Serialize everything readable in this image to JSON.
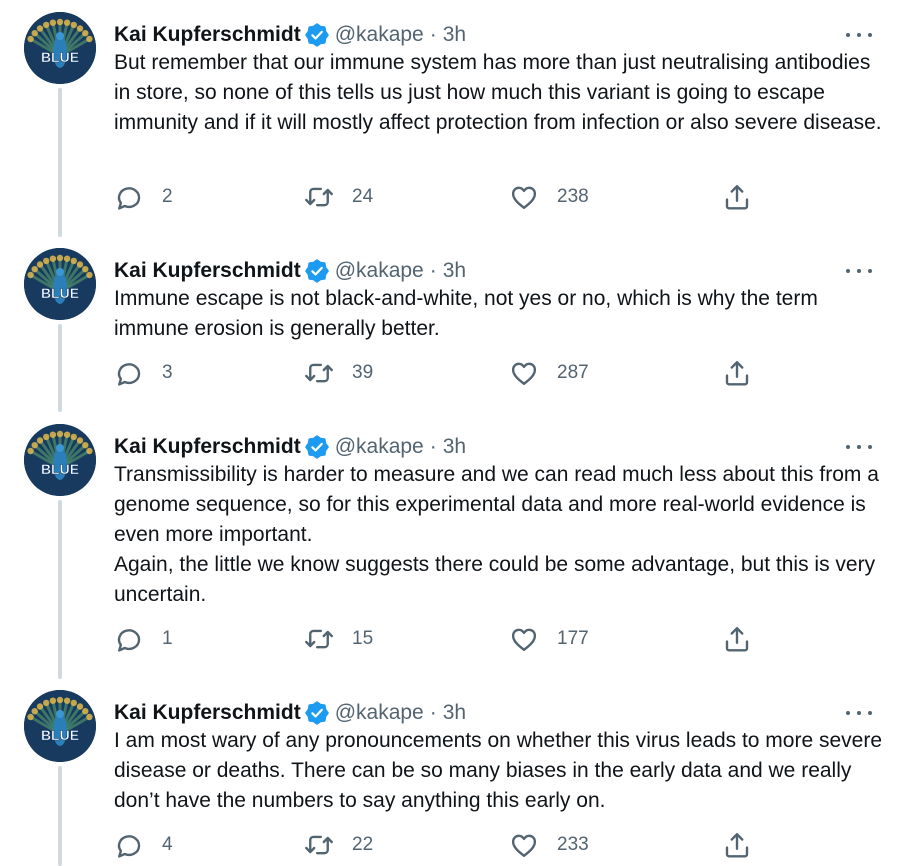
{
  "colors": {
    "verified_badge": "#1d9bf0",
    "secondary_text": "#536471",
    "thread_line": "#cfd9de"
  },
  "avatar_text": "BLUE",
  "tweets": [
    {
      "author_name": "Kai Kupferschmidt",
      "handle": "@kakape",
      "separator": "·",
      "time": "3h",
      "text": [
        "But remember that our immune system has more than just neutralising antibodies in store, so none of this tells us just how much this variant is going to escape immunity and if it will mostly affect protection from infection or also severe disease."
      ],
      "replies": "2",
      "retweets": "24",
      "likes": "238"
    },
    {
      "author_name": "Kai Kupferschmidt",
      "handle": "@kakape",
      "separator": "·",
      "time": "3h",
      "text": [
        "Immune escape is not black-and-white, not yes or no, which is why the term immune erosion is generally better."
      ],
      "replies": "3",
      "retweets": "39",
      "likes": "287"
    },
    {
      "author_name": "Kai Kupferschmidt",
      "handle": "@kakape",
      "separator": "·",
      "time": "3h",
      "text": [
        "Transmissibility is harder to measure and we can read much less about this from a genome sequence, so for this experimental data and more real-world evidence is even more important.",
        "Again, the little we know suggests there could be some advantage, but this is very uncertain."
      ],
      "replies": "1",
      "retweets": "15",
      "likes": "177"
    },
    {
      "author_name": "Kai Kupferschmidt",
      "handle": "@kakape",
      "separator": "·",
      "time": "3h",
      "text": [
        "I am most wary of any pronouncements on whether this virus leads to more severe disease or deaths. There can be so many biases in the early data and we really don’t have the numbers to say anything this early on."
      ],
      "replies": "4",
      "retweets": "22",
      "likes": "233"
    }
  ]
}
